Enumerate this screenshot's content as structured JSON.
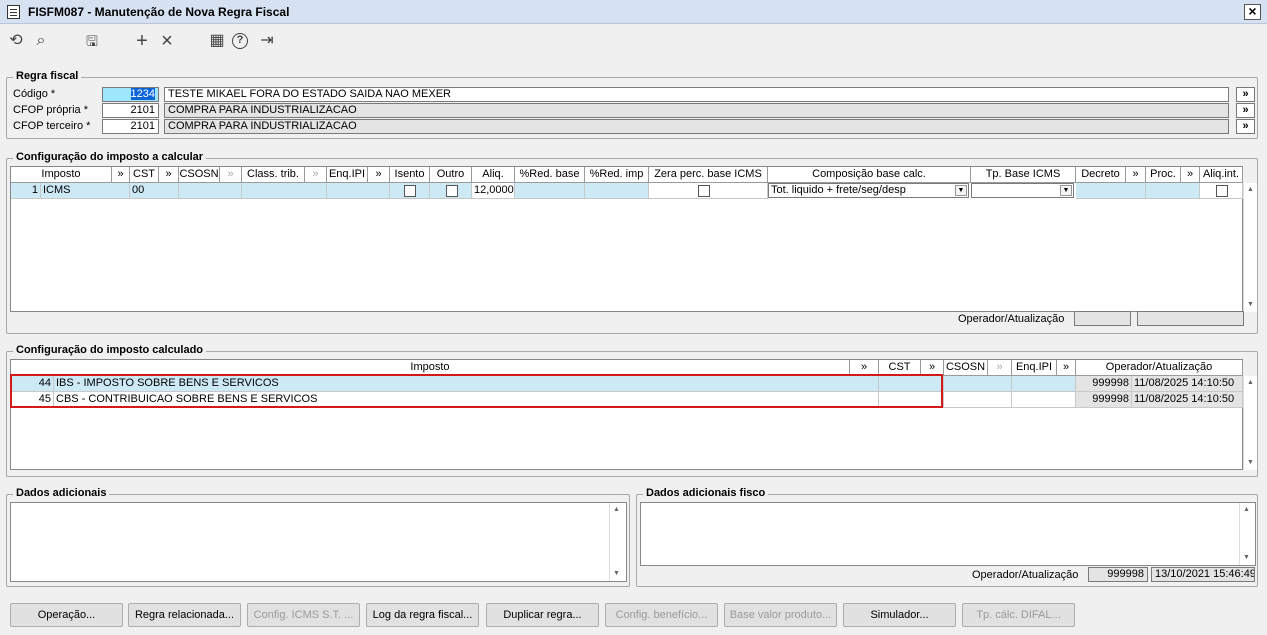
{
  "window": {
    "title": "FISFM087 - Manutenção de Nova Regra Fiscal",
    "close": "×"
  },
  "toolbar": {
    "refresh": "⟲",
    "search": "⌕",
    "save": "🖫",
    "add": "+",
    "remove": "×",
    "calendar": "▦",
    "help": "?",
    "exit": "⇥"
  },
  "regra": {
    "legend": "Regra fiscal",
    "codigo_label": "Código *",
    "codigo_value": "1234",
    "codigo_desc": "TESTE MIKAEL FORA DO ESTADO SAIDA NAO MEXER",
    "cfop_propria_label": "CFOP própria *",
    "cfop_propria_value": "2101",
    "cfop_propria_desc": "COMPRA PARA INDUSTRIALIZACAO",
    "cfop_terceiro_label": "CFOP terceiro *",
    "cfop_terceiro_value": "2101",
    "cfop_terceiro_desc": "COMPRA PARA INDUSTRIALIZACAO",
    "arrow": "»"
  },
  "calc": {
    "legend": "Configuração do imposto a calcular",
    "headers": {
      "imposto": "Imposto",
      "cst": "CST",
      "csosn": "CSOSN",
      "class_trib": "Class. trib.",
      "enq_ipi": "Enq.IPI",
      "isento": "Isento",
      "outro": "Outro",
      "aliq": "Aliq.",
      "red_base": "%Red. base",
      "red_imp": "%Red. imp",
      "zera": "Zera perc. base ICMS",
      "composicao": "Composição base calc.",
      "tp_base": "Tp. Base ICMS",
      "decreto": "Decreto",
      "proc": "Proc.",
      "aliq_int": "Aliq.int."
    },
    "arrow": "»",
    "row": {
      "num": "1",
      "imposto": "ICMS",
      "cst": "00",
      "aliq": "12,0000",
      "composicao": "Tot. liquido + frete/seg/desp"
    },
    "operador_label": "Operador/Atualização"
  },
  "calculado": {
    "legend": "Configuração do imposto calculado",
    "headers": {
      "imposto": "Imposto",
      "cst": "CST",
      "csosn": "CSOSN",
      "enq_ipi": "Enq.IPI",
      "operador": "Operador/Atualização"
    },
    "arrow": "»",
    "rows": [
      {
        "num": "44",
        "imposto": "IBS - IMPOSTO SOBRE BENS E SERVICOS",
        "operador": "999998",
        "data": "11/08/2025 14:10:50"
      },
      {
        "num": "45",
        "imposto": "CBS - CONTRIBUICAO SOBRE BENS E SERVICOS",
        "operador": "999998",
        "data": "11/08/2025 14:10:50"
      }
    ]
  },
  "dados": {
    "legend": "Dados adicionais"
  },
  "dados_fisco": {
    "legend": "Dados adicionais fisco",
    "operador_label": "Operador/Atualização",
    "operador": "999998",
    "data": "13/10/2021 15:46:49"
  },
  "buttons": {
    "operacao": "Operação...",
    "regra_relacionada": "Regra relacionada...",
    "config_icms": "Config. ICMS S.T. ...",
    "log": "Log da regra fiscal...",
    "duplicar": "Duplicar regra...",
    "config_beneficio": "Config. benefício...",
    "base_valor": "Base valor produto...",
    "simulador": "Simulador...",
    "tp_calc": "Tp. cálc. DIFAL..."
  }
}
